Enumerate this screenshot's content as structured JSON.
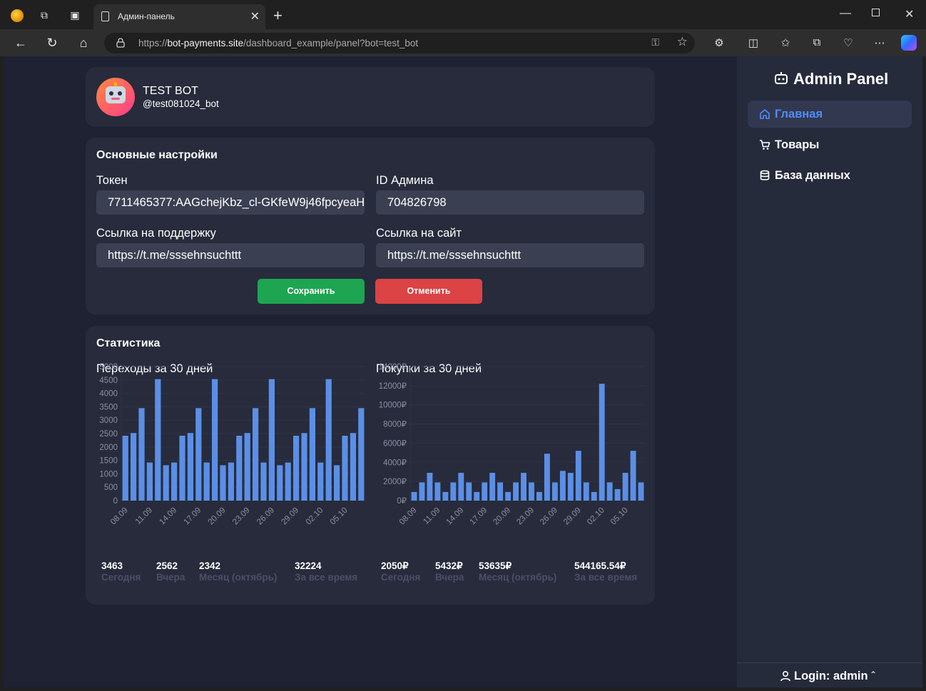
{
  "browser": {
    "tab_title": "Админ-панель",
    "url_prefix": "https://",
    "url_host": "bot-payments.site",
    "url_path": "/dashboard_example/panel?bot=test_bot"
  },
  "profile": {
    "name": "TEST BOT",
    "handle": "@test081024_bot"
  },
  "settings": {
    "heading": "Основные настройки",
    "token_label": "Токен",
    "token_value": "7711465377:AAGchejKbz_cl-GKfeW9j46fpcyeaH",
    "admin_id_label": "ID Админа",
    "admin_id_value": "704826798",
    "support_label": "Ссылка на поддержку",
    "support_value": "https://t.me/sssehnsuchttt",
    "site_label": "Ссылка на сайт",
    "site_value": "https://t.me/sssehnsuchttt",
    "save_label": "Сохранить",
    "cancel_label": "Отменить"
  },
  "stats": {
    "heading": "Статистика",
    "visits": {
      "title": "Переходы за 30 дней",
      "today": "3463",
      "today_label": "Сегодня",
      "yesterday": "2562",
      "yesterday_label": "Вчера",
      "month": "2342",
      "month_label": "Месяц (октябрь)",
      "all": "32224",
      "all_label": "За все время"
    },
    "purchases": {
      "title": "Покупки за 30 дней",
      "today": "2050₽",
      "today_label": "Сегодня",
      "yesterday": "5432₽",
      "yesterday_label": "Вчера",
      "month": "53635₽",
      "month_label": "Месяц (октябрь)",
      "all": "544165.54₽",
      "all_label": "За все время"
    }
  },
  "chart_data": [
    {
      "type": "bar",
      "title": "Переходы за 30 дней",
      "color": "#5b8fe6",
      "ylim": [
        0,
        5000
      ],
      "yticks": [
        0,
        500,
        1000,
        1500,
        2000,
        2500,
        3000,
        3500,
        4000,
        4500,
        5000
      ],
      "ytick_suffix": "",
      "xtick_labels": [
        "08.09",
        "11.09",
        "14.09",
        "17.09",
        "20.09",
        "23.09",
        "26.09",
        "29.09",
        "02.10",
        "05.10"
      ],
      "values": [
        2420,
        2520,
        3450,
        1420,
        4530,
        1320,
        1420,
        2420,
        2520,
        3450,
        1420,
        4530,
        1320,
        1420,
        2420,
        2520,
        3450,
        1420,
        4530,
        1320,
        1420,
        2420,
        2520,
        3450,
        1420,
        4530,
        1320,
        2420,
        2520,
        3450
      ]
    },
    {
      "type": "bar",
      "title": "Покупки за 30 дней",
      "color": "#5b8fe6",
      "ylim": [
        0,
        14000
      ],
      "yticks": [
        0,
        2000,
        4000,
        6000,
        8000,
        10000,
        12000,
        14000
      ],
      "ytick_suffix": "₽",
      "xtick_labels": [
        "08.09",
        "11.09",
        "14.09",
        "17.09",
        "20.09",
        "23.09",
        "26.09",
        "29.09",
        "02.10",
        "05.10"
      ],
      "values": [
        900,
        1900,
        2900,
        1900,
        900,
        1900,
        2900,
        1900,
        900,
        1900,
        2900,
        1900,
        900,
        1900,
        2900,
        1900,
        900,
        4900,
        1900,
        3100,
        2900,
        5200,
        1900,
        900,
        12200,
        1900,
        1200,
        2900,
        5200,
        1900
      ]
    }
  ],
  "sidebar": {
    "title": "Admin Panel",
    "items": [
      {
        "label": "Главная"
      },
      {
        "label": "Товары"
      },
      {
        "label": "База данных"
      }
    ],
    "login": "Login: admin"
  }
}
